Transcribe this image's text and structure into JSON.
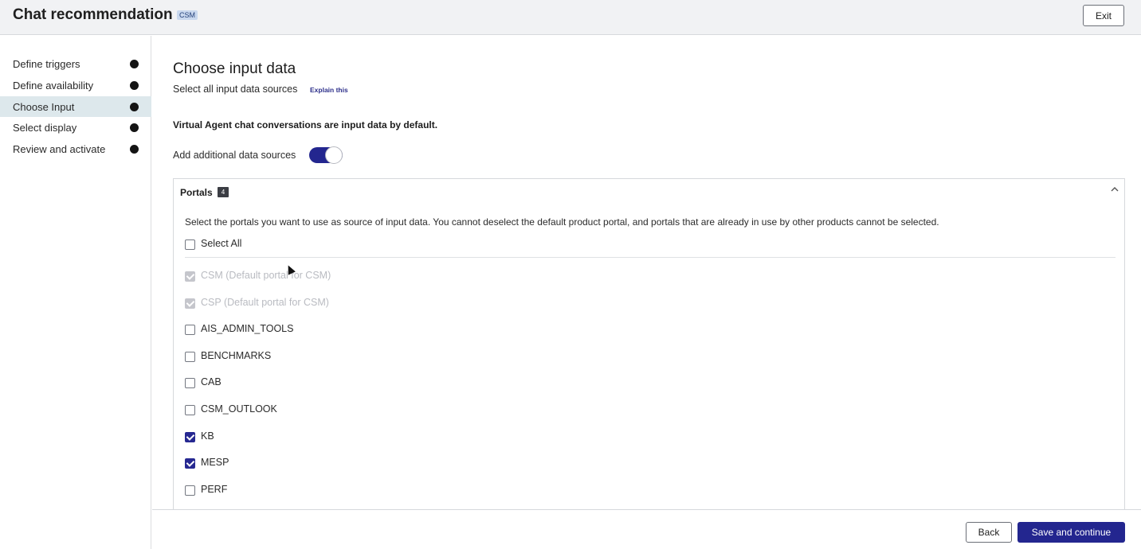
{
  "header": {
    "title": "Chat recommendation",
    "badge": "CSM",
    "exit_label": "Exit"
  },
  "sidebar": {
    "steps": [
      {
        "label": "Define triggers",
        "status": "complete"
      },
      {
        "label": "Define availability",
        "status": "complete"
      },
      {
        "label": "Choose Input",
        "status": "current"
      },
      {
        "label": "Select display",
        "status": "complete"
      },
      {
        "label": "Review and activate",
        "status": "complete"
      }
    ]
  },
  "main": {
    "title": "Choose input data",
    "subtitle": "Select all input data sources",
    "explain_link": "Explain this",
    "va_note": "Virtual Agent chat conversations are input data by default.",
    "toggle_label": "Add additional data sources",
    "toggle_on": true
  },
  "portals": {
    "title": "Portals",
    "count": "4",
    "description": "Select the portals you want to use as source of input data. You cannot deselect the default product portal, and portals that are already in use by other products cannot be selected.",
    "select_all_label": "Select All",
    "items": [
      {
        "label": "CSM (Default portal for CSM)",
        "checked": true,
        "disabled": true
      },
      {
        "label": "CSP (Default portal for CSM)",
        "checked": true,
        "disabled": true
      },
      {
        "label": "AIS_ADMIN_TOOLS",
        "checked": false,
        "disabled": false
      },
      {
        "label": "BENCHMARKS",
        "checked": false,
        "disabled": false
      },
      {
        "label": "CAB",
        "checked": false,
        "disabled": false
      },
      {
        "label": "CSM_OUTLOOK",
        "checked": false,
        "disabled": false
      },
      {
        "label": "KB",
        "checked": true,
        "disabled": false
      },
      {
        "label": "MESP",
        "checked": true,
        "disabled": false
      },
      {
        "label": "PERF",
        "checked": false,
        "disabled": false
      }
    ]
  },
  "footer": {
    "back_label": "Back",
    "save_label": "Save and continue"
  },
  "colors": {
    "accent": "#23268f",
    "active_step_bg": "#dde8ec",
    "header_bg": "#f1f2f4"
  }
}
